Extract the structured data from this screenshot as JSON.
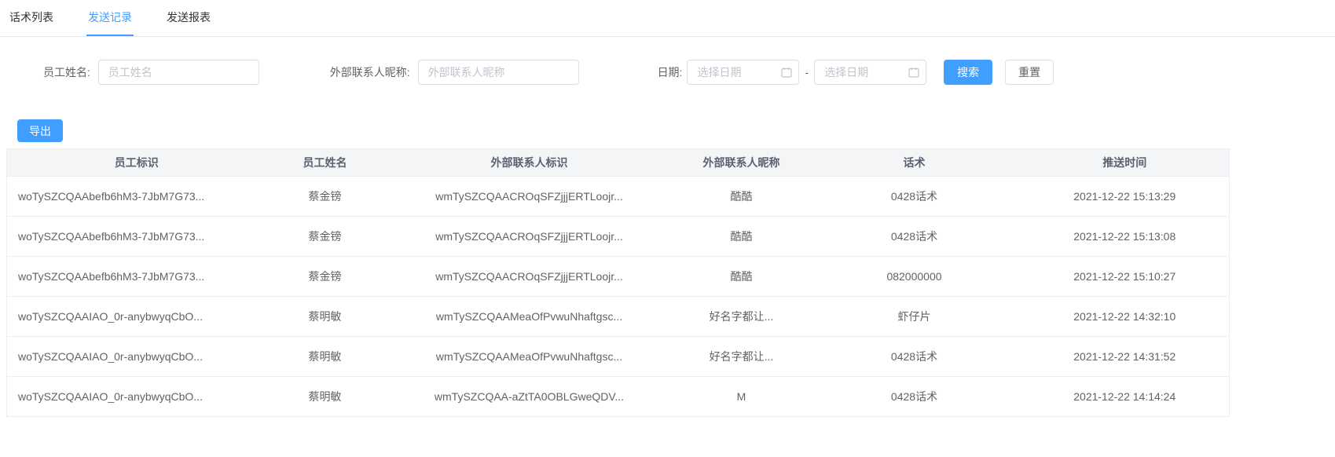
{
  "colors": {
    "accent": "#409eff"
  },
  "tabs": [
    {
      "label": "话术列表",
      "active": false
    },
    {
      "label": "发送记录",
      "active": true
    },
    {
      "label": "发送报表",
      "active": false
    }
  ],
  "filters": {
    "employee_name": {
      "label": "员工姓名:",
      "placeholder": "员工姓名"
    },
    "contact_nickname": {
      "label": "外部联系人昵称:",
      "placeholder": "外部联系人昵称"
    },
    "date": {
      "label": "日期:",
      "start_placeholder": "选择日期",
      "end_placeholder": "选择日期",
      "separator": "-"
    },
    "search_label": "搜索",
    "reset_label": "重置"
  },
  "toolbar": {
    "export_label": "导出"
  },
  "table": {
    "columns": [
      "员工标识",
      "员工姓名",
      "外部联系人标识",
      "外部联系人昵称",
      "话术",
      "推送时间"
    ],
    "rows": [
      [
        "woTySZCQAAbefb6hM3-7JbM7G73...",
        "蔡金镑",
        "wmTySZCQAACROqSFZjjjERTLoojr...",
        "酷酷",
        "0428话术",
        "2021-12-22 15:13:29"
      ],
      [
        "woTySZCQAAbefb6hM3-7JbM7G73...",
        "蔡金镑",
        "wmTySZCQAACROqSFZjjjERTLoojr...",
        "酷酷",
        "0428话术",
        "2021-12-22 15:13:08"
      ],
      [
        "woTySZCQAAbefb6hM3-7JbM7G73...",
        "蔡金镑",
        "wmTySZCQAACROqSFZjjjERTLoojr...",
        "酷酷",
        "082000000",
        "2021-12-22 15:10:27"
      ],
      [
        "woTySZCQAAIAO_0r-anybwyqCbO...",
        "蔡明敏",
        "wmTySZCQAAMeaOfPvwuNhaftgsc...",
        "好名字都让...",
        "虾仔片",
        "2021-12-22 14:32:10"
      ],
      [
        "woTySZCQAAIAO_0r-anybwyqCbO...",
        "蔡明敏",
        "wmTySZCQAAMeaOfPvwuNhaftgsc...",
        "好名字都让...",
        "0428话术",
        "2021-12-22 14:31:52"
      ],
      [
        "woTySZCQAAIAO_0r-anybwyqCbO...",
        "蔡明敏",
        "wmTySZCQAA-aZtTA0OBLGweQDV...",
        "M",
        "0428话术",
        "2021-12-22 14:14:24"
      ]
    ]
  }
}
